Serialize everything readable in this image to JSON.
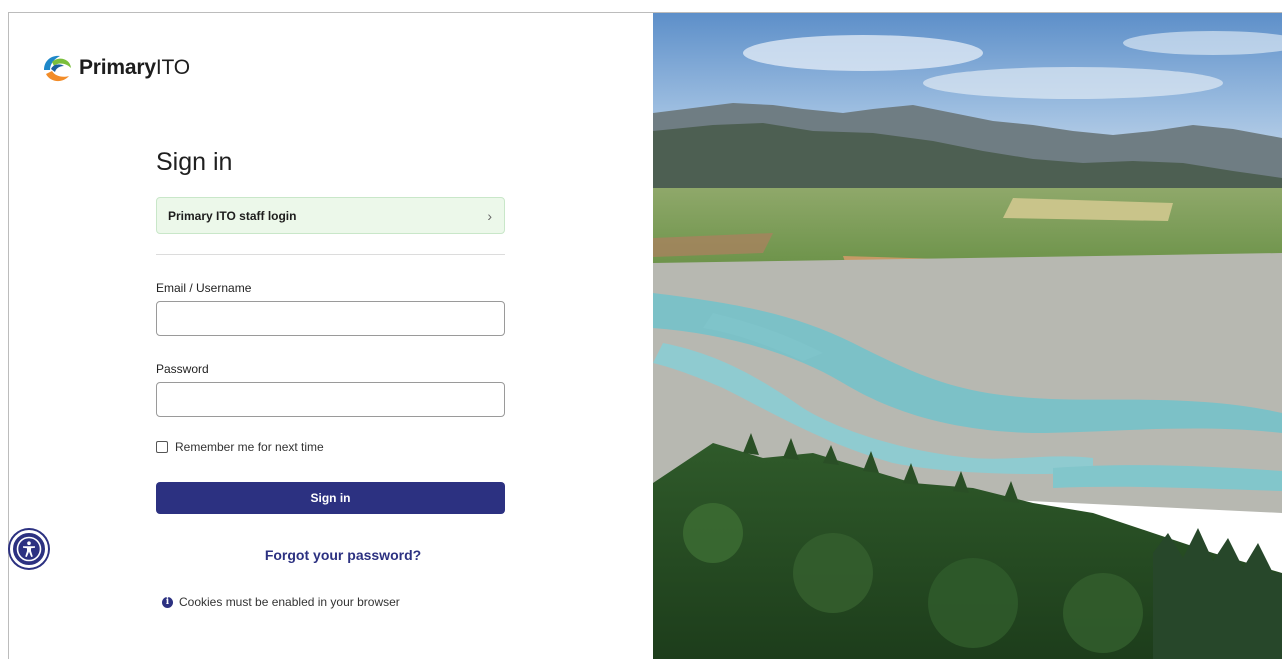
{
  "brand": {
    "name_bold": "Primary",
    "name_light": "ITO"
  },
  "form": {
    "heading": "Sign in",
    "staff_login_label": "Primary ITO staff login",
    "email_label": "Email / Username",
    "email_value": "",
    "password_label": "Password",
    "password_value": "",
    "remember_label": "Remember me for next time",
    "signin_label": "Sign in"
  },
  "links": {
    "forgot_password": "Forgot your password?"
  },
  "notice": {
    "cookies": "Cookies must be enabled in your browser"
  },
  "icons": {
    "logo": "primary-ito-logo",
    "staff_chevron": "chevron-right-icon",
    "info": "info-icon",
    "accessibility": "accessibility-icon"
  },
  "colors": {
    "accent": "#2c3181",
    "staff_button_bg": "#ecf8ea",
    "staff_button_border": "#c9e7c9"
  }
}
